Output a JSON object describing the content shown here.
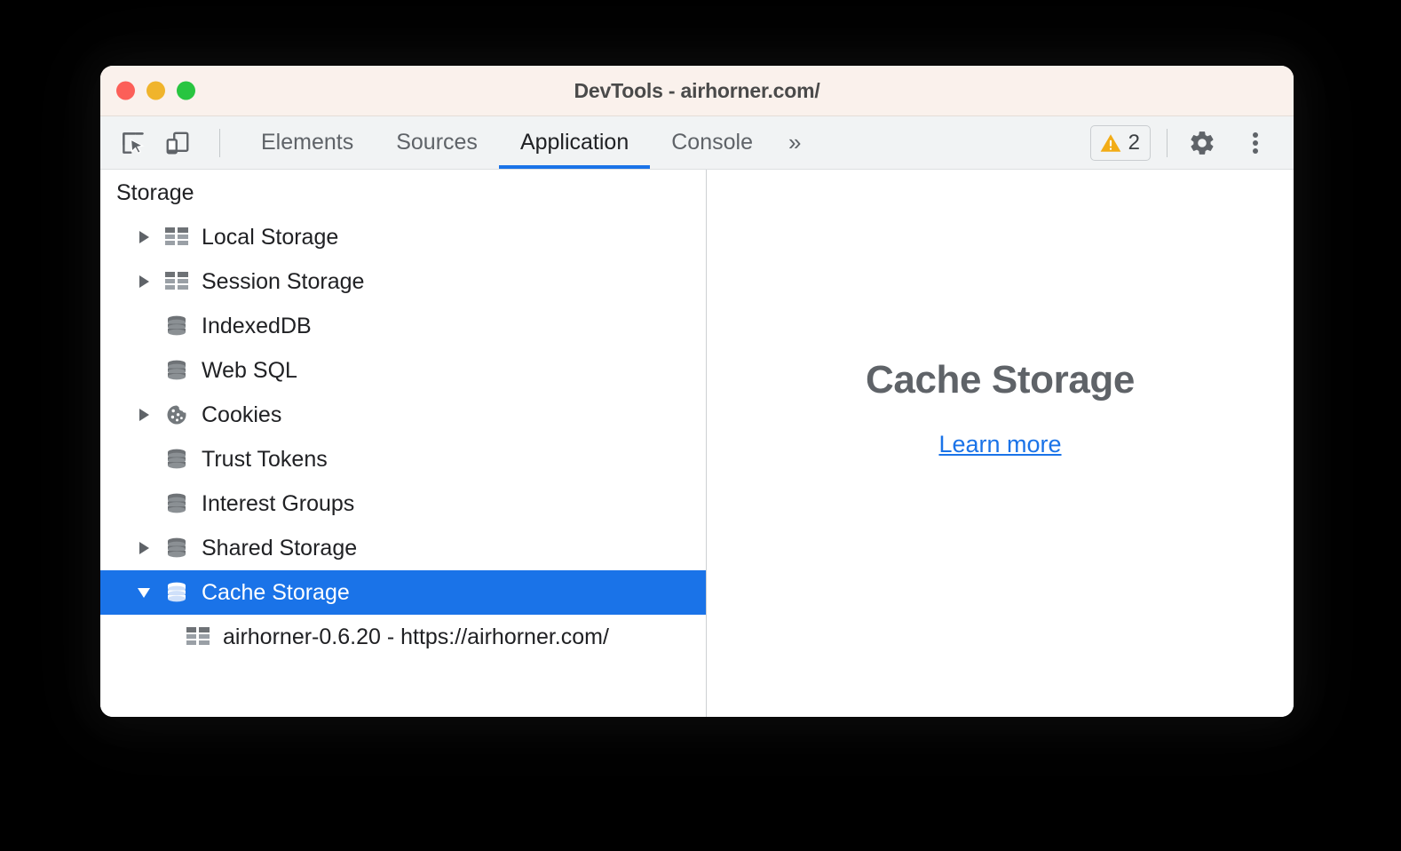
{
  "window": {
    "title": "DevTools - airhorner.com/",
    "traffic_lights": [
      "close",
      "minimize",
      "maximize"
    ],
    "colors": {
      "titlebar_bg": "#faf1ec",
      "toolbar_bg": "#f1f3f4",
      "accent": "#1a73e8",
      "selection_bg": "#1a73e8",
      "warning": "#f2ac16",
      "text": "#202124",
      "muted_text": "#5f6368",
      "light_red": "#fc5f58",
      "light_yellow": "#f0b42c",
      "light_green": "#28c540"
    }
  },
  "toolbar": {
    "inspect_icon": "inspect-element-icon",
    "device_icon": "device-toolbar-icon",
    "tabs": [
      {
        "label": "Elements",
        "active": false
      },
      {
        "label": "Sources",
        "active": false
      },
      {
        "label": "Application",
        "active": true
      },
      {
        "label": "Console",
        "active": false
      }
    ],
    "more_tabs_label": "»",
    "warning_badge": {
      "icon": "warning-triangle-icon",
      "count": "2"
    },
    "settings_icon": "gear-icon",
    "menu_icon": "kebab-menu-icon"
  },
  "sidebar": {
    "section_title": "Storage",
    "items": [
      {
        "label": "Local Storage",
        "icon": "table-icon",
        "twisty": "collapsed",
        "depth": 0,
        "selected": false
      },
      {
        "label": "Session Storage",
        "icon": "table-icon",
        "twisty": "collapsed",
        "depth": 0,
        "selected": false
      },
      {
        "label": "IndexedDB",
        "icon": "database-icon",
        "twisty": "none",
        "depth": 0,
        "selected": false
      },
      {
        "label": "Web SQL",
        "icon": "database-icon",
        "twisty": "none",
        "depth": 0,
        "selected": false
      },
      {
        "label": "Cookies",
        "icon": "cookie-icon",
        "twisty": "collapsed",
        "depth": 0,
        "selected": false
      },
      {
        "label": "Trust Tokens",
        "icon": "database-icon",
        "twisty": "none",
        "depth": 0,
        "selected": false
      },
      {
        "label": "Interest Groups",
        "icon": "database-icon",
        "twisty": "none",
        "depth": 0,
        "selected": false
      },
      {
        "label": "Shared Storage",
        "icon": "database-icon",
        "twisty": "collapsed",
        "depth": 0,
        "selected": false
      },
      {
        "label": "Cache Storage",
        "icon": "database-icon",
        "twisty": "expanded",
        "depth": 0,
        "selected": true
      },
      {
        "label": "airhorner-0.6.20 - https://airhorner.com/",
        "icon": "table-icon",
        "twisty": "none",
        "depth": 1,
        "selected": false
      }
    ]
  },
  "main": {
    "empty_title": "Cache Storage",
    "learn_more_label": "Learn more"
  }
}
